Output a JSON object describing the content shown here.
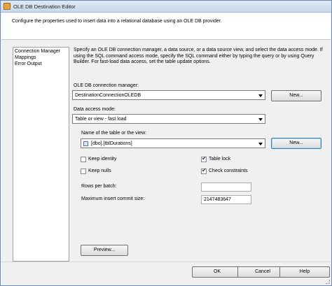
{
  "window": {
    "title": "OLE DB Destination Editor"
  },
  "header": {
    "text": "Configure the properties used to insert data into a relational database using an OLE DB provider."
  },
  "nav": {
    "items": [
      {
        "label": "Connection Manager"
      },
      {
        "label": "Mappings"
      },
      {
        "label": "Error Output"
      }
    ]
  },
  "main": {
    "description": "Specify an OLE DB connection manager, a data source, or a data source view, and select the data access mode. If using the SQL command access mode, specify the SQL command either by typing the query or by using Query Builder. For fast-load data access, set the table update options.",
    "connection_label": "OLE DB connection manager:",
    "connection_value": "DestinationConnectionOLEDB",
    "new_label": "New...",
    "access_mode_label": "Data access mode:",
    "access_mode_value": "Table or view - fast load",
    "table_label": "Name of the table or the view:",
    "table_value": "[dbo].[tblDurations]",
    "new_table_label": "New...",
    "options": {
      "keep_identity": {
        "label": "Keep identity",
        "checked": false
      },
      "keep_nulls": {
        "label": "Keep nulls",
        "checked": false
      },
      "table_lock": {
        "label": "Table lock",
        "checked": true
      },
      "check_constraints": {
        "label": "Check constraints",
        "checked": true
      }
    },
    "rows_per_batch_label": "Rows per batch:",
    "rows_per_batch_value": "",
    "max_commit_label": "Maximum insert commit size:",
    "max_commit_value": "2147483647",
    "preview_label": "Preview..."
  },
  "footer": {
    "ok": "OK",
    "cancel": "Cancel",
    "help": "Help"
  },
  "icons": {
    "check": "✔"
  }
}
